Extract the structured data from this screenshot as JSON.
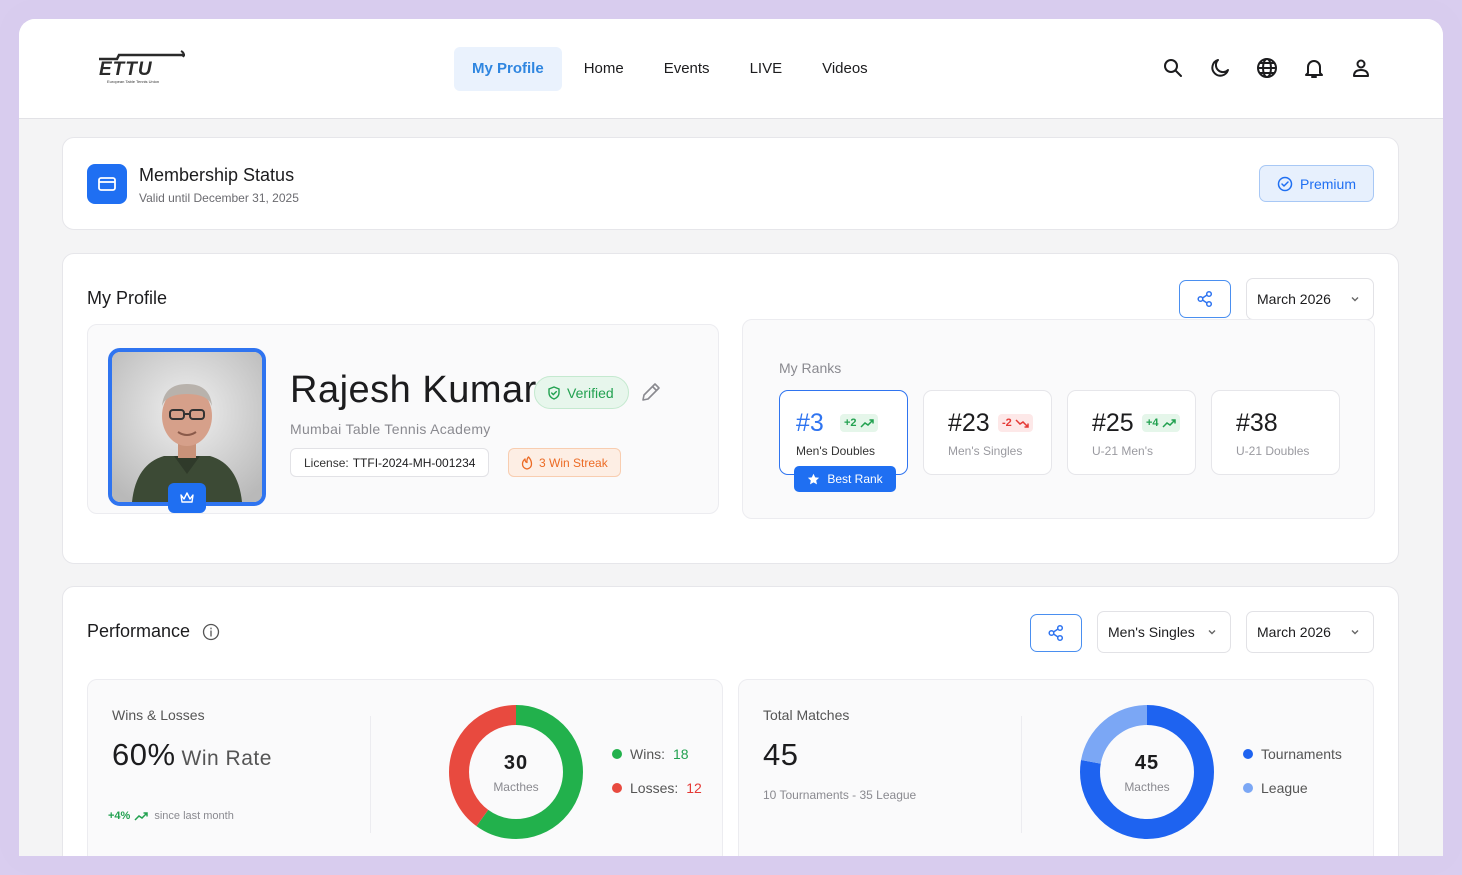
{
  "brand": {
    "logo_text": "ETTU",
    "logo_subtext": "European Table Tennis Union"
  },
  "nav": {
    "items": [
      {
        "label": "My Profile",
        "active": true
      },
      {
        "label": "Home",
        "active": false
      },
      {
        "label": "Events",
        "active": false
      },
      {
        "label": "LIVE",
        "active": false
      },
      {
        "label": "Videos",
        "active": false
      }
    ],
    "icons": [
      "search-icon",
      "moon-icon",
      "globe-icon",
      "bell-icon",
      "user-icon"
    ]
  },
  "membership": {
    "title": "Membership Status",
    "valid_until": "Valid until December 31, 2025",
    "tier_label": "Premium"
  },
  "profile": {
    "section_title": "My Profile",
    "period_select": "March 2026",
    "player": {
      "name": "Rajesh Kumar",
      "verified_label": "Verified",
      "academy": "Mumbai Table Tennis Academy",
      "license_label": "License:",
      "license_value": "TTFI-2024-MH-001234",
      "streak_label": "3 Win Streak"
    },
    "ranks": {
      "label": "My Ranks",
      "best_rank_label": "Best Rank",
      "items": [
        {
          "rank": "#3",
          "delta": "+2",
          "trend": "up",
          "category": "Men's Doubles",
          "best": true
        },
        {
          "rank": "#23",
          "delta": "-2",
          "trend": "down",
          "category": "Men's Singles",
          "best": false
        },
        {
          "rank": "#25",
          "delta": "+4",
          "trend": "up",
          "category": "U-21 Men's",
          "best": false
        },
        {
          "rank": "#38",
          "delta": "",
          "trend": "none",
          "category": "U-21 Doubles",
          "best": false
        }
      ]
    }
  },
  "performance": {
    "section_title": "Performance",
    "category_select": "Men's Singles",
    "period_select": "March 2026",
    "wins_losses": {
      "label": "Wins & Losses",
      "win_rate": "60%",
      "win_rate_suffix": "Win Rate",
      "trend_value": "+4%",
      "trend_caption": "since last month",
      "center_value": "30",
      "center_caption": "Macthes",
      "legend": [
        {
          "label": "Wins:",
          "value": "18",
          "color": "#22b14c"
        },
        {
          "label": "Losses:",
          "value": "12",
          "color": "#e84a3f"
        }
      ]
    },
    "total_matches": {
      "label": "Total Matches",
      "value": "45",
      "breakdown": "10 Tournaments - 35 League",
      "center_value": "45",
      "center_caption": "Macthes",
      "legend": [
        {
          "label": "Tournaments",
          "color": "#1e63f0"
        },
        {
          "label": "League",
          "color": "#7ba7f5"
        }
      ]
    }
  },
  "colors": {
    "accent": "#1f6ff2",
    "success": "#22a150",
    "danger": "#e53935",
    "streak": "#ec6b25"
  },
  "chart_data": [
    {
      "type": "pie",
      "categories": [
        "Wins",
        "Losses"
      ],
      "values": [
        18,
        12
      ],
      "colors": [
        "#22b14c",
        "#e84a3f"
      ]
    },
    {
      "type": "pie",
      "categories": [
        "Tournaments",
        "League"
      ],
      "values": [
        35,
        10
      ],
      "colors": [
        "#1e63f0",
        "#7ba7f5"
      ]
    }
  ]
}
